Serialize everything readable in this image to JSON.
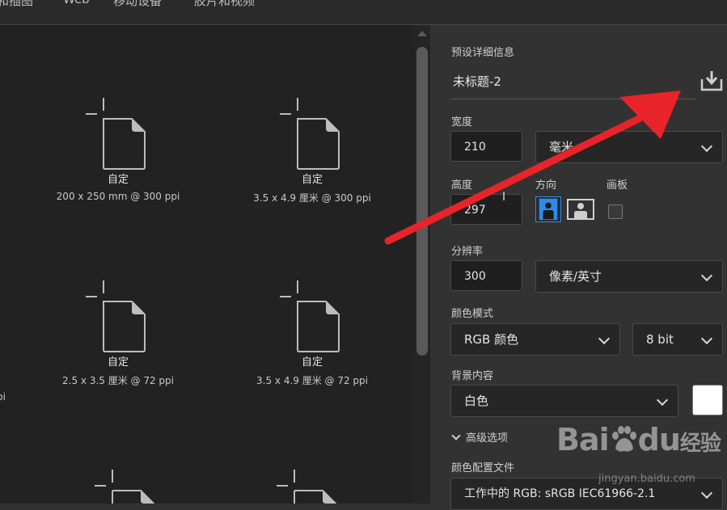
{
  "top_tabs": [
    "和插图",
    "Web",
    "移动设备",
    "胶片和视频"
  ],
  "presets": [
    {
      "name": "自定",
      "size": "200 x 250 mm @ 300 ppi"
    },
    {
      "name": "自定",
      "size": "3.5 x 4.9 厘米 @ 300 ppi"
    },
    {
      "name": "自定",
      "size": "2.5 x 3.5 厘米 @ 72 ppi"
    },
    {
      "name": "自定",
      "size": "3.5 x 4.9 厘米 @ 72 ppi"
    }
  ],
  "left_edge_fragment": "pi",
  "details": {
    "header": "预设详细信息",
    "doc_title": "未标题-2",
    "width_label": "宽度",
    "width_value": "210",
    "width_unit": "毫米",
    "height_label": "高度",
    "height_value": "297",
    "orientation_label": "方向",
    "artboard_label": "画板",
    "resolution_label": "分辨率",
    "resolution_value": "300",
    "resolution_unit": "像素/英寸",
    "color_mode_label": "颜色模式",
    "color_mode_value": "RGB 颜色",
    "bit_depth_value": "8 bit",
    "background_label": "背景内容",
    "background_value": "白色",
    "advanced_label": "高级选项",
    "profile_label": "颜色配置文件",
    "profile_value": "工作中的 RGB: sRGB IEC61966-2.1"
  },
  "watermark": {
    "brand": "Bai",
    "brand2": "du",
    "suffix": "经验",
    "url": "jingyan.baidu.com"
  },
  "colors": {
    "accent": "#2d8ceb",
    "arrow": "#e8232a",
    "swatch": "#ffffff"
  }
}
